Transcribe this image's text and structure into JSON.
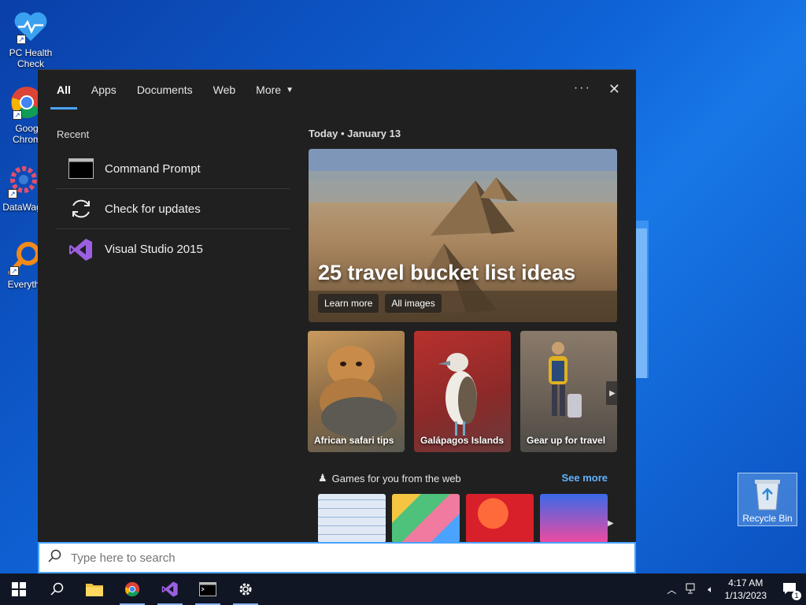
{
  "desktop": {
    "icons": [
      {
        "label": "PC Health Check"
      },
      {
        "label": "Goog Chrom"
      },
      {
        "label": "DataWag"
      },
      {
        "label": "Everyth"
      }
    ],
    "recycle_bin": "Recycle Bin"
  },
  "search_panel": {
    "tabs": [
      "All",
      "Apps",
      "Documents",
      "Web",
      "More"
    ],
    "recent_heading": "Recent",
    "recent_items": [
      "Command Prompt",
      "Check for updates",
      "Visual Studio 2015"
    ],
    "today_label": "Today",
    "today_date": "January 13",
    "hero": {
      "title": "25 travel bucket list ideas",
      "learn_more": "Learn more",
      "all_images": "All images"
    },
    "cards": [
      "African safari tips",
      "Galápagos Islands",
      "Gear up for travel"
    ],
    "games_heading": "Games for you from the web",
    "see_more": "See more"
  },
  "searchbar": {
    "placeholder": "Type here to search"
  },
  "taskbar": {
    "time": "4:17 AM",
    "date": "1/13/2023",
    "notifications": "1"
  },
  "colors": {
    "accent": "#4aa3ff",
    "panel_bg": "#202020",
    "taskbar_bg": "#101623"
  }
}
